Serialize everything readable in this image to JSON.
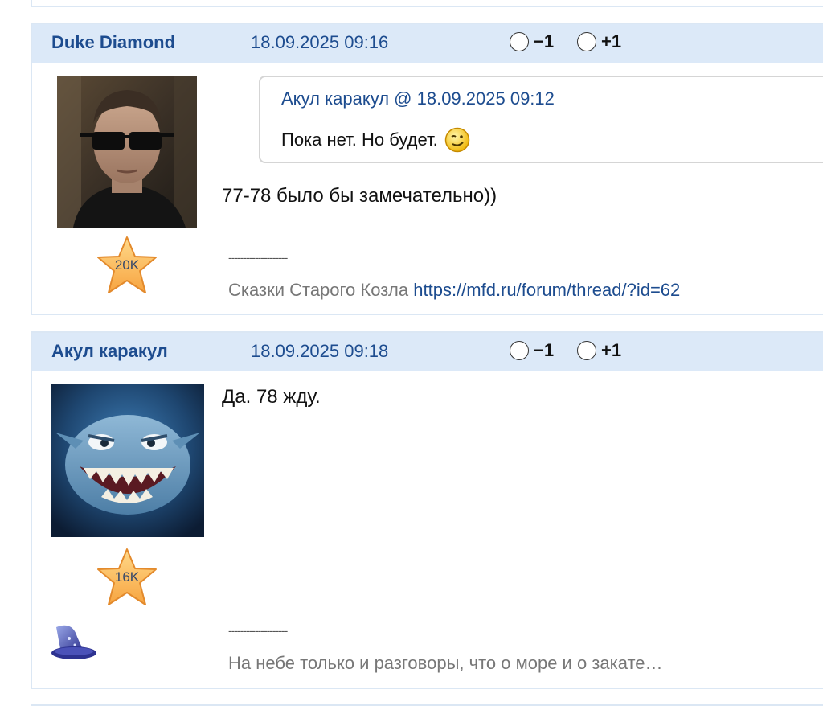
{
  "posts": [
    {
      "author": "Duke Diamond",
      "date": "18.09.2025 09:16",
      "vote_minus": "−1",
      "vote_plus": "+1",
      "quote": {
        "author_line": "Акул каракул @ 18.09.2025 09:12",
        "text": "Пока нет. Но будет."
      },
      "body": "77-78 было бы замечательно))",
      "badge": "20K",
      "signature_divider": "--------------------",
      "signature_text": "Сказки Старого Козла ",
      "signature_link": "https://mfd.ru/forum/thread/?id=62"
    },
    {
      "author": "Акул каракул",
      "date": "18.09.2025 09:18",
      "vote_minus": "−1",
      "vote_plus": "+1",
      "body": "Да. 78 жду.",
      "badge": "16K",
      "signature_divider": "--------------------",
      "signature_text": "На небе только и разговоры, что о море и о закате…"
    }
  ],
  "colors": {
    "header_bg": "#dce9f8",
    "link": "#1d4c8f",
    "border": "#dbe7f4"
  },
  "icons": [
    "smiley-wink-icon",
    "star-badge-icon",
    "wizard-hat-icon",
    "radio-icon"
  ]
}
